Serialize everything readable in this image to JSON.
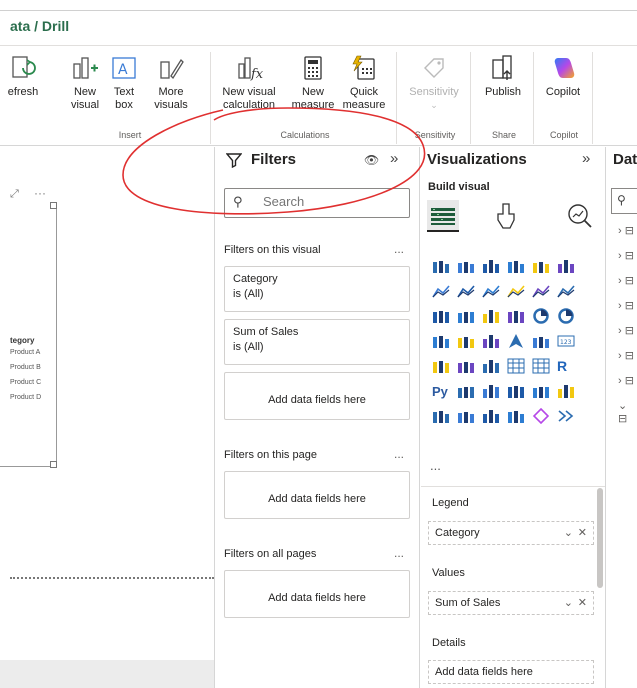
{
  "header": {
    "breadcrumb": "ata / Drill"
  },
  "ribbon": {
    "refresh": "efresh",
    "new_visual": "New visual",
    "text_box": "Text box",
    "more_visuals": "More visuals",
    "new_visual_calc": "New visual calculation",
    "new_measure": "New measure",
    "quick_measure": "Quick measure",
    "sensitivity": "Sensitivity",
    "publish": "Publish",
    "copilot": "Copilot",
    "groups": {
      "insert": "Insert",
      "calculations": "Calculations",
      "sensitivity": "Sensitivity",
      "share": "Share",
      "copilot": "Copilot"
    }
  },
  "canvas": {
    "legend_title": "tegory",
    "legend_items": [
      "Product A",
      "Product B",
      "Product C",
      "Product D"
    ]
  },
  "filters": {
    "title": "Filters",
    "search_placeholder": "Search",
    "on_visual": "Filters on this visual",
    "category_field": "Category",
    "category_value": "is (All)",
    "sales_field": "Sum of Sales",
    "sales_value": "is (All)",
    "add_fields": "Add data fields here",
    "on_page": "Filters on this page",
    "on_all": "Filters on all pages",
    "more": "..."
  },
  "visualizations": {
    "title": "Visualizations",
    "build_visual": "Build visual",
    "legend_label": "Legend",
    "legend_value": "Category",
    "values_label": "Values",
    "values_value": "Sum of Sales",
    "details_label": "Details",
    "details_placeholder": "Add data fields here",
    "more": "..."
  },
  "data_pane": {
    "title": "Dat",
    "search_placeholder": ""
  },
  "colors": {
    "accent": "#2b6e4d",
    "annotation": "#e03030"
  }
}
